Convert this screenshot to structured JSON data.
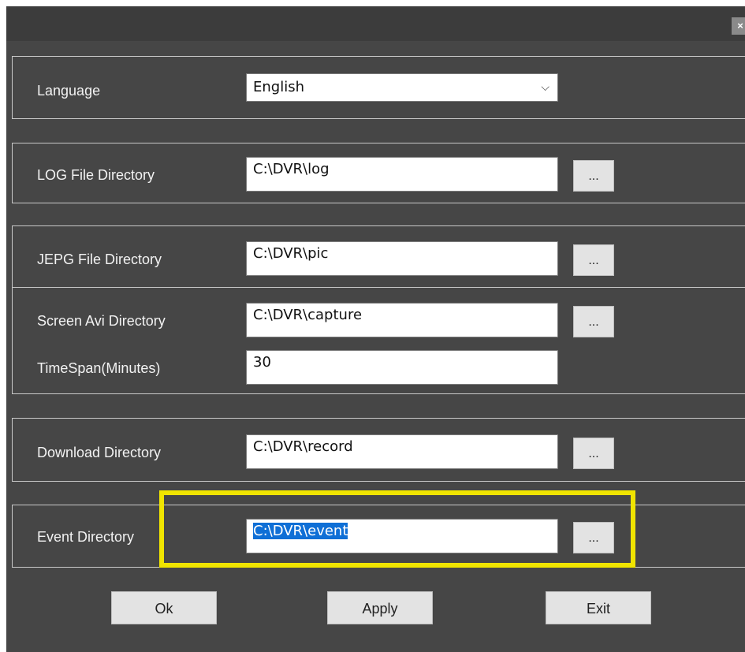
{
  "window": {
    "close_glyph": "×"
  },
  "language": {
    "label": "Language",
    "value": "English",
    "icon": "chevron-down-icon",
    "chevron": "⌵"
  },
  "log_dir": {
    "label": "LOG File Directory",
    "value": "C:\\DVR\\log",
    "browse": "..."
  },
  "jpeg_dir": {
    "label": "JEPG File Directory",
    "value": "C:\\DVR\\pic",
    "browse": "..."
  },
  "avi_dir": {
    "label": "Screen Avi Directory",
    "value": "C:\\DVR\\capture",
    "browse": "..."
  },
  "timespan": {
    "label": "TimeSpan(Minutes)",
    "value": "30"
  },
  "download_dir": {
    "label": "Download Directory",
    "value": "C:\\DVR\\record",
    "browse": "..."
  },
  "event_dir": {
    "label": "Event Directory",
    "value": "C:\\DVR\\event",
    "browse": "..."
  },
  "buttons": {
    "ok": "Ok",
    "apply": "Apply",
    "exit": "Exit"
  },
  "colors": {
    "background": "#464646",
    "highlight": "#f0e400",
    "selection": "#0f6fd6"
  }
}
